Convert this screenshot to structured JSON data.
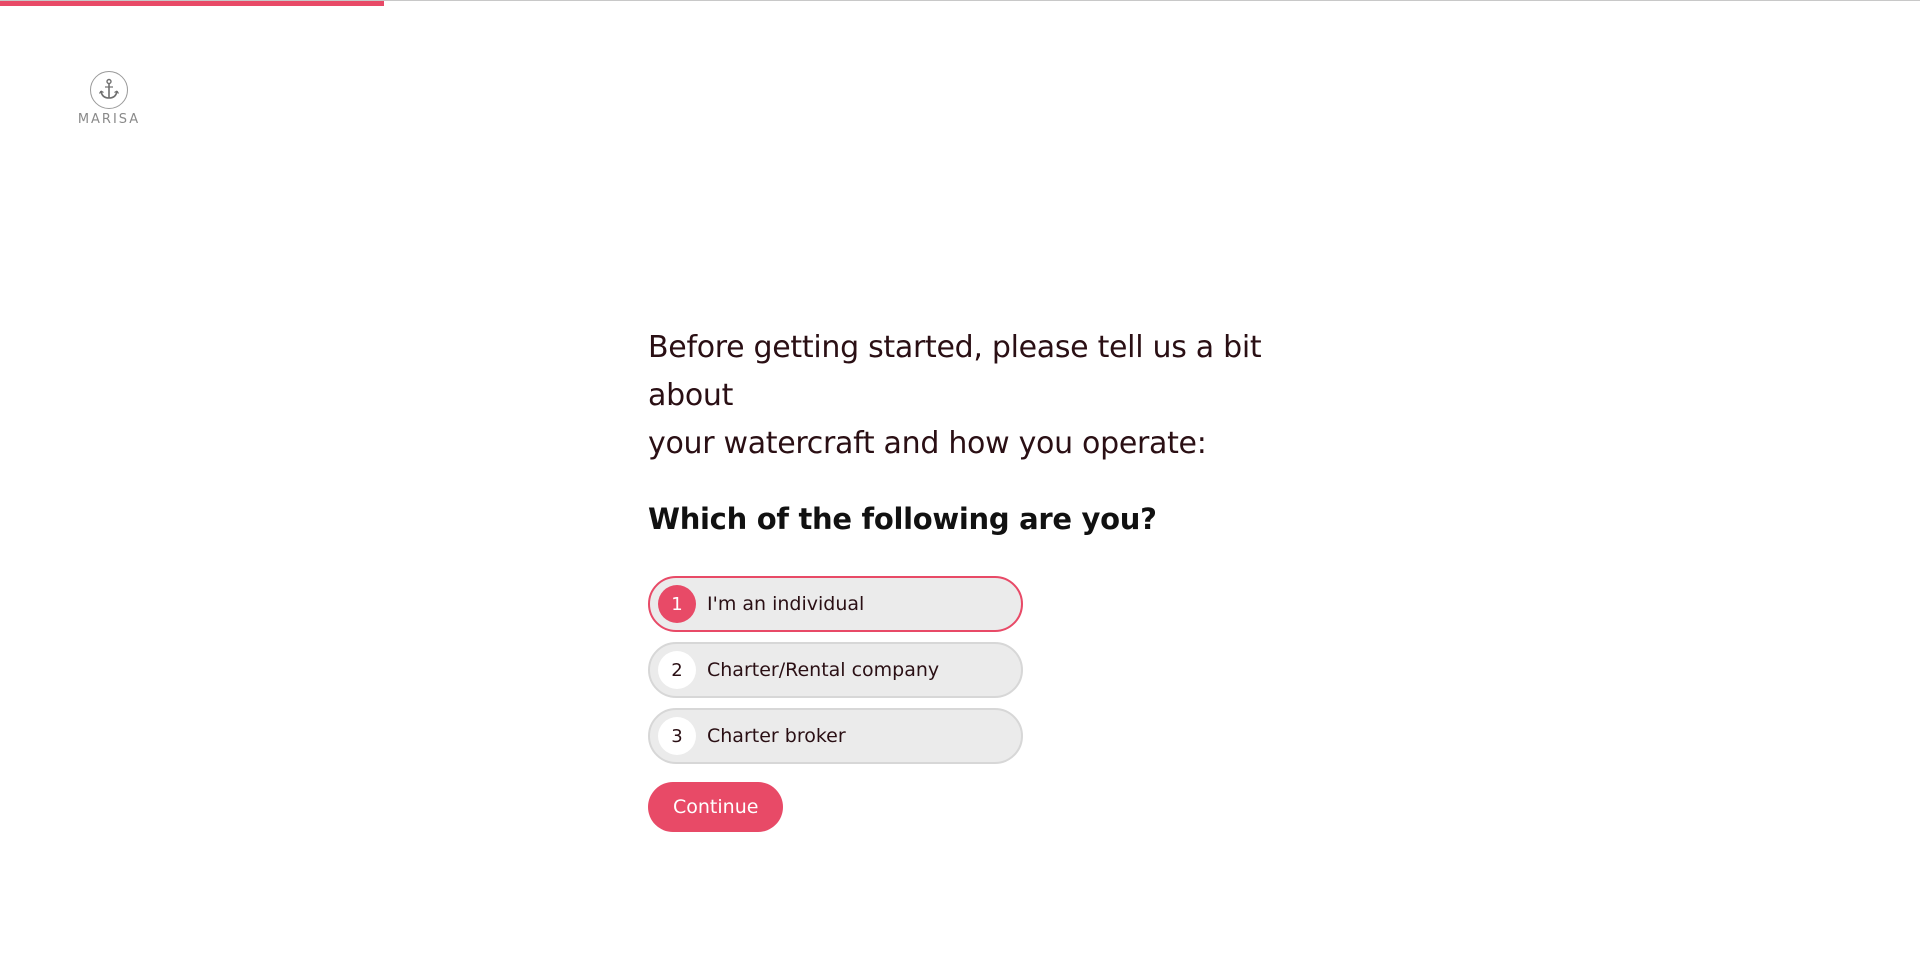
{
  "progress": {
    "fraction": 0.2
  },
  "logo": {
    "text": "MARISA",
    "icon": "anchor-icon"
  },
  "intro": {
    "line1": "Before getting started, please tell us a bit about",
    "line2": "your watercraft and how you operate:"
  },
  "question": "Which of the following are you?",
  "options": [
    {
      "number": "1",
      "label": "I'm an individual",
      "selected": true
    },
    {
      "number": "2",
      "label": "Charter/Rental company",
      "selected": false
    },
    {
      "number": "3",
      "label": "Charter broker",
      "selected": false
    }
  ],
  "continue_label": "Continue",
  "colors": {
    "accent": "#e84a67",
    "text": "#2a0f14",
    "option_bg": "#ebebeb",
    "option_border": "#d7d7d7"
  }
}
